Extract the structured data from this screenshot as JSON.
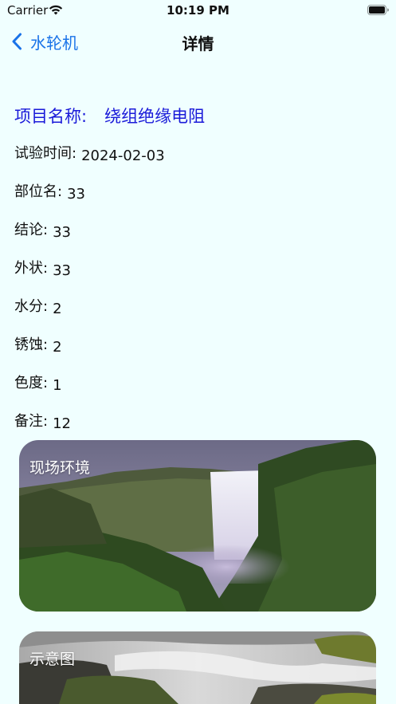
{
  "status_bar": {
    "carrier": "Carrier",
    "time": "10:19 PM"
  },
  "nav": {
    "back_label": "水轮机",
    "title": "详情"
  },
  "project": {
    "label": "项目名称:",
    "value": "绕组绝缘电阻"
  },
  "fields": [
    {
      "label": "试验时间:",
      "value": "2024-02-03"
    },
    {
      "label": "部位名:",
      "value": "33"
    },
    {
      "label": "结论:",
      "value": "33"
    },
    {
      "label": "外状:",
      "value": "33"
    },
    {
      "label": "水分:",
      "value": "2"
    },
    {
      "label": "锈蚀:",
      "value": "2"
    },
    {
      "label": "色度:",
      "value": "1"
    },
    {
      "label": "备注:",
      "value": "12"
    }
  ],
  "cards": [
    {
      "label": "现场环境"
    },
    {
      "label": "示意图"
    }
  ]
}
